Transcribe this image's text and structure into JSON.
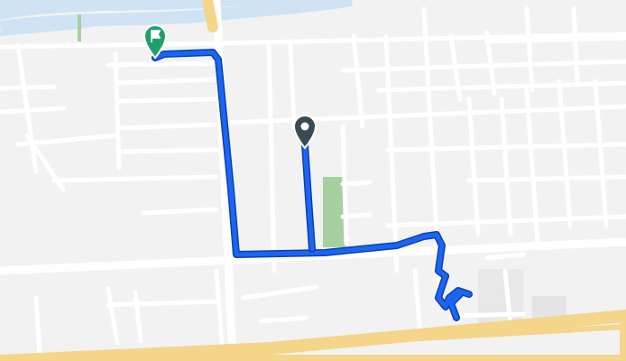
{
  "map": {
    "colors": {
      "background": "#f2f2f2",
      "road": "#ffffff",
      "major_road": "#f5d58a",
      "water": "#cfe3f4",
      "park": "#a8cfa0",
      "building": "#e4e4e4",
      "route": "#1a66f2",
      "route_casing": "#0d3fae",
      "origin_pin": "#3a4a55",
      "destination_pin": "#1fa06a"
    },
    "markers": [
      {
        "name": "origin-marker",
        "icon": "map-pin-icon"
      },
      {
        "name": "destination-marker",
        "icon": "flag-pin-icon"
      }
    ],
    "route": {
      "mode": "walking"
    }
  }
}
